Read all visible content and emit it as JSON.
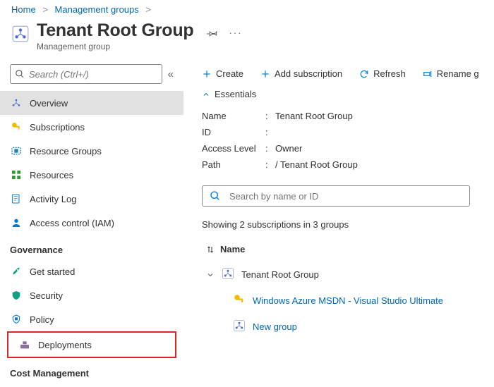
{
  "breadcrumb": {
    "home": "Home",
    "mg": "Management groups"
  },
  "header": {
    "title": "Tenant Root Group",
    "subtitle": "Management group"
  },
  "sidebar": {
    "search_placeholder": "Search (Ctrl+/)",
    "items": {
      "overview": "Overview",
      "subscriptions": "Subscriptions",
      "resourceGroups": "Resource Groups",
      "resources": "Resources",
      "activityLog": "Activity Log",
      "accessControl": "Access control (IAM)"
    },
    "governance_head": "Governance",
    "governance": {
      "getStarted": "Get started",
      "security": "Security",
      "policy": "Policy",
      "deployments": "Deployments"
    },
    "cost_head": "Cost Management"
  },
  "toolbar": {
    "create": "Create",
    "addSubscription": "Add subscription",
    "refresh": "Refresh",
    "rename": "Rename g"
  },
  "essentials": {
    "head": "Essentials",
    "name_k": "Name",
    "name_v": "Tenant Root Group",
    "id_k": "ID",
    "id_v": "",
    "access_k": "Access Level",
    "access_v": "Owner",
    "path_k": "Path",
    "path_v": "/ Tenant Root Group"
  },
  "tree": {
    "search_placeholder": "Search by name or ID",
    "showing": "Showing 2 subscriptions in 3 groups",
    "name_col": "Name",
    "root": "Tenant Root Group",
    "child_sub": "Windows Azure MSDN - Visual Studio Ultimate",
    "child_group": "New group"
  }
}
